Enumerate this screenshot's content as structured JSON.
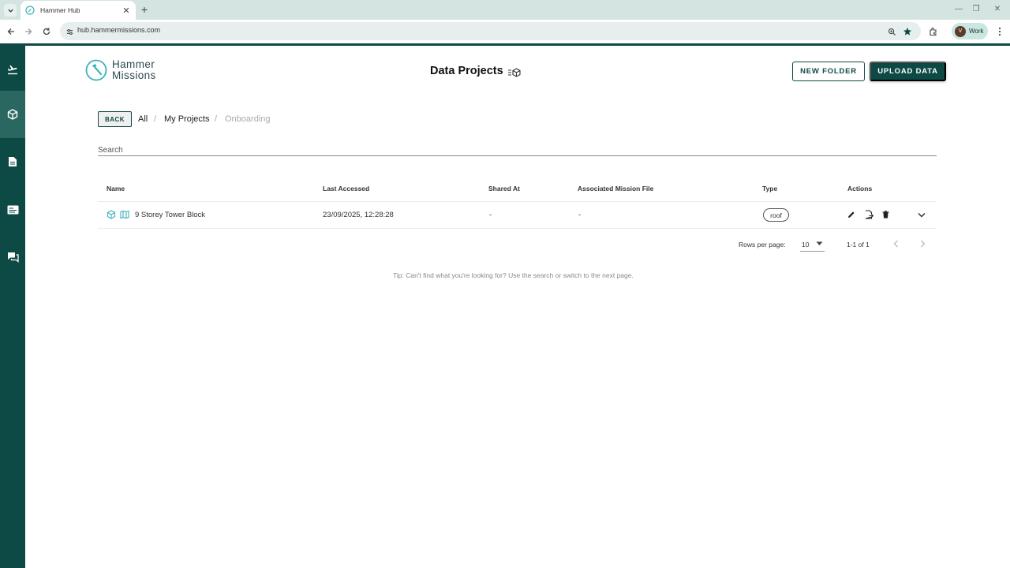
{
  "browser": {
    "tab_title": "Hammer Hub",
    "url": "hub.hammermissions.com",
    "profile_initial": "V",
    "profile_label": "Work"
  },
  "sidebar": {
    "items": [
      {
        "icon": "flight-icon",
        "active": false
      },
      {
        "icon": "cube-icon",
        "active": true
      },
      {
        "icon": "document-icon",
        "active": false
      },
      {
        "icon": "card-icon",
        "active": false
      },
      {
        "icon": "chat-icon",
        "active": false
      }
    ]
  },
  "header": {
    "logo_line1": "Hammer",
    "logo_line2": "Missions",
    "title": "Data Projects",
    "new_folder_label": "NEW FOLDER",
    "upload_label": "UPLOAD DATA"
  },
  "breadcrumb": {
    "back_label": "BACK",
    "items": [
      "All",
      "My Projects",
      "Onboarding"
    ],
    "separator": "/"
  },
  "search": {
    "placeholder": "Search"
  },
  "table": {
    "columns": [
      "Name",
      "Last Accessed",
      "Shared At",
      "Associated Mission File",
      "Type",
      "Actions"
    ],
    "rows": [
      {
        "name": "9 Storey Tower Block",
        "last_accessed": "23/09/2025, 12:28:28",
        "shared_at": "-",
        "mission_file": "-",
        "type": "roof"
      }
    ]
  },
  "pagination": {
    "rows_per_page_label": "Rows per page:",
    "rows_per_page": "10",
    "range": "1-1 of 1"
  },
  "tip": "Tip: Can't find what you're looking for? Use the search or switch to the next page.",
  "colors": {
    "brand": "#0e4a45",
    "brand_active": "#2b6761",
    "accent": "#3bb3b8"
  }
}
